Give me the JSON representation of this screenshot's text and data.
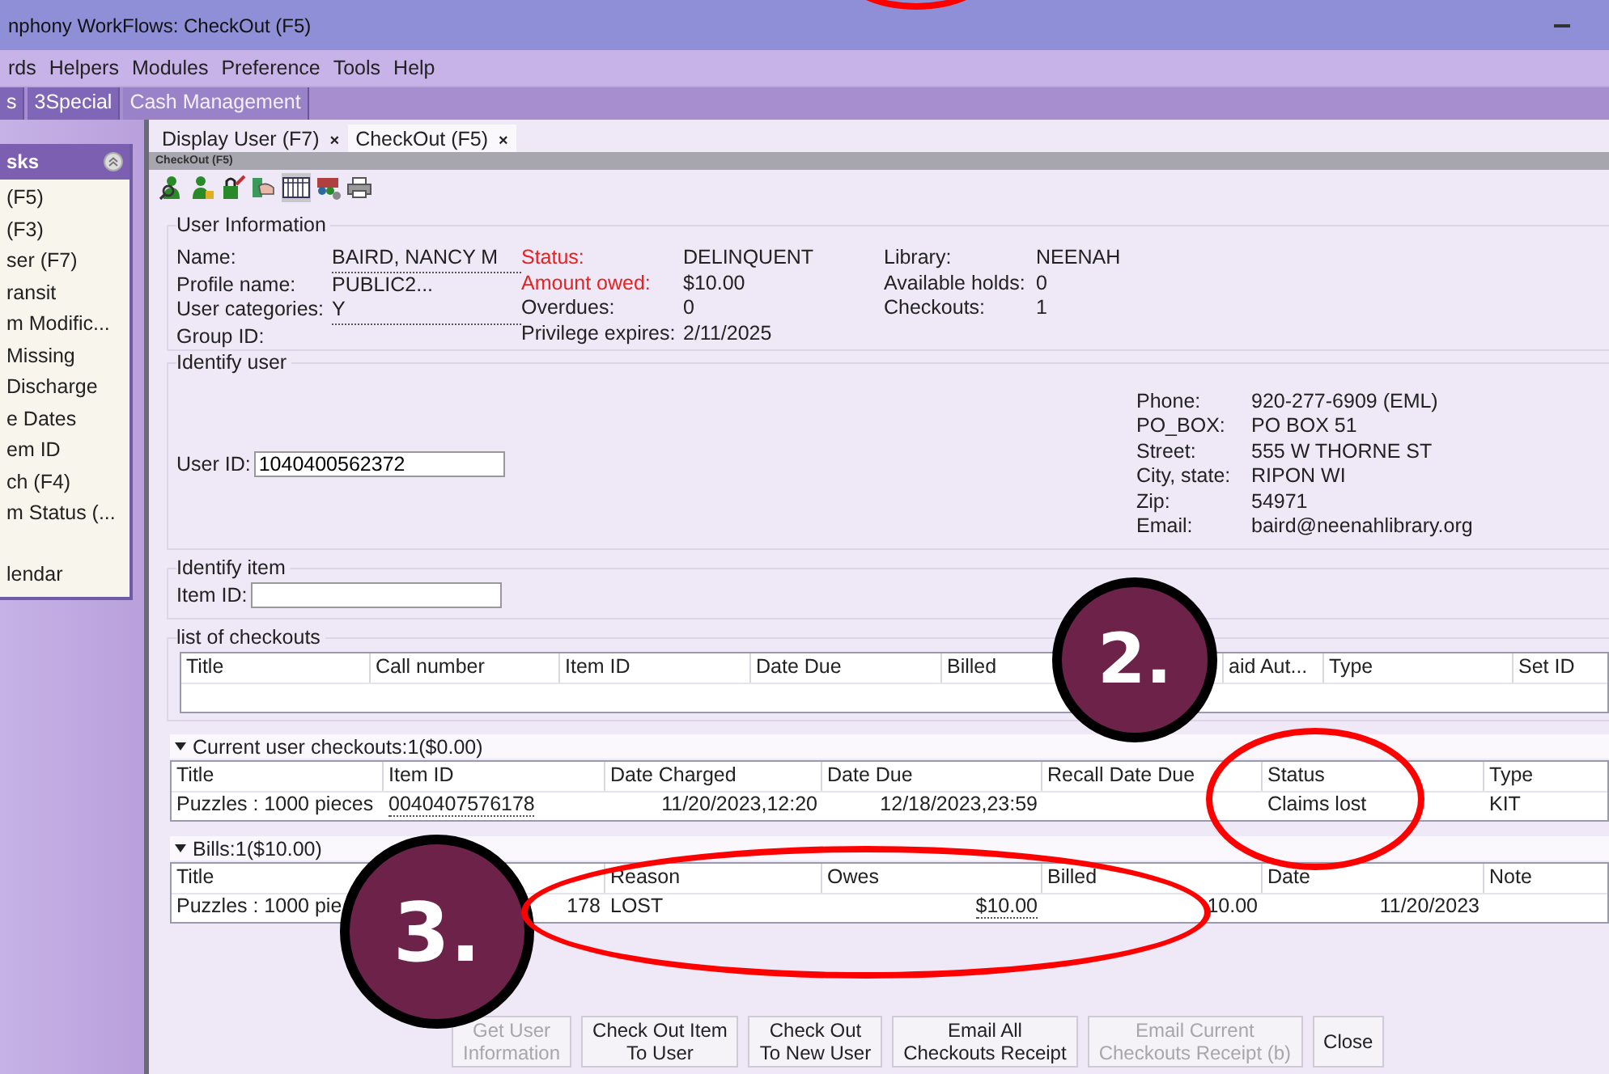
{
  "window": {
    "title": "nphony WorkFlows: CheckOut (F5)"
  },
  "menu": [
    "rds",
    "Helpers",
    "Modules",
    "Preference",
    "Tools",
    "Help"
  ],
  "toolbar_tabs": [
    {
      "label": "s",
      "selected": false
    },
    {
      "label": "3Special",
      "selected": false
    },
    {
      "label": "Cash Management",
      "selected": true
    }
  ],
  "sidebar": {
    "title": "sks",
    "groups": [
      [
        "(F5)",
        "(F3)",
        "ser (F7)",
        "ransit",
        "m Modific...",
        "Missing",
        "Discharge",
        "e Dates",
        "em ID",
        "ch (F4)",
        "m Status (..."
      ],
      [
        "lendar"
      ]
    ]
  },
  "tabs": [
    {
      "label": "Display User (F7)",
      "close": "×",
      "selected": false
    },
    {
      "label": "CheckOut (F5)",
      "close": "×",
      "selected": true
    }
  ],
  "panel_title": "CheckOut (F5)",
  "user_information": {
    "legend": "User Information",
    "columns": [
      [
        {
          "label": "Name:",
          "value": "BAIRD, NANCY M",
          "link": true,
          "alert": false
        },
        {
          "label": "Profile name:",
          "value": "PUBLIC2...",
          "link": false,
          "alert": false
        },
        {
          "label": "User categories:",
          "value": "Y",
          "link": true,
          "alert": false
        },
        {
          "label": "Group ID:",
          "alert": false
        }
      ],
      [
        {
          "label": "Status:",
          "value": "DELINQUENT",
          "link": false,
          "alert": true
        },
        {
          "label": "Amount owed:",
          "value": "$10.00",
          "link": false,
          "alert": true
        },
        {
          "label": "Overdues:",
          "value": "0",
          "link": false,
          "alert": false
        },
        {
          "label": "Privilege expires:",
          "value": "2/11/2025",
          "link": false,
          "alert": false
        }
      ],
      [
        {
          "label": "Library:",
          "value": "NEENAH",
          "link": false,
          "alert": false
        },
        {
          "label": "Available holds:",
          "value": "0",
          "link": false,
          "alert": false
        },
        {
          "label": "Checkouts:",
          "value": "1",
          "link": false,
          "alert": false
        }
      ]
    ]
  },
  "identify_user": {
    "legend": "Identify user",
    "field_label": "User ID:",
    "value": "1040400562372",
    "contact": [
      {
        "label": "Phone:",
        "value": "920-277-6909 (EML)"
      },
      {
        "label": "PO_BOX:",
        "value": "PO BOX 51"
      },
      {
        "label": "Street:",
        "value": "555 W THORNE ST"
      },
      {
        "label": "City, state:",
        "value": "RIPON WI"
      },
      {
        "label": "Zip:",
        "value": "54971"
      },
      {
        "label": "Email:",
        "value": "baird@neenahlibrary.org"
      }
    ]
  },
  "identify_item": {
    "legend": "Identify item",
    "field_label": "Item ID:"
  },
  "list_of_checkouts": {
    "legend": "list of checkouts",
    "columns": [
      "Title",
      "Call number",
      "Item ID",
      "Date Due",
      "Billed",
      "aid Aut...",
      "Type",
      "Set ID"
    ]
  },
  "current_checkouts": {
    "header": "Current user checkouts:1($0.00)",
    "expanded": true,
    "columns": [
      "Title",
      "Item ID",
      "Date Charged",
      "Date Due",
      "Recall Date Due",
      "Status",
      "Type"
    ],
    "rows": [
      [
        {
          "text": "Puzzles : 1000 pieces",
          "link": false
        },
        {
          "text": "0040407576178",
          "link": true
        },
        {
          "text": "11/20/2023,12:20",
          "link": false
        },
        {
          "text": "12/18/2023,23:59",
          "link": false
        },
        {
          "text": ""
        },
        {
          "text": "Claims lost",
          "link": false
        },
        {
          "text": "KIT",
          "link": false
        }
      ]
    ]
  },
  "bills": {
    "header": "Bills:1($10.00)",
    "expanded": true,
    "columns": [
      "Title",
      "",
      "Reason",
      "Owes",
      "Billed",
      "Date",
      "Note"
    ],
    "rows": [
      [
        {
          "text": "Puzzles : 1000 pie",
          "link": false
        },
        {
          "text": "178",
          "link": false
        },
        {
          "text": "LOST",
          "link": false
        },
        {
          "text": "$10.00",
          "link": true
        },
        {
          "text": "10.00",
          "link": false
        },
        {
          "text": "11/20/2023",
          "link": false
        },
        {
          "text": ""
        }
      ]
    ]
  },
  "buttons": [
    {
      "label": "Get User\nInformation",
      "disabled": true
    },
    {
      "label": "Check Out Item\nTo User",
      "disabled": false
    },
    {
      "label": "Check Out\nTo New User",
      "disabled": false
    },
    {
      "label": "Email All\nCheckouts Receipt",
      "disabled": false
    },
    {
      "label": "Email Current\nCheckouts Receipt (b)",
      "disabled": true
    },
    {
      "label": "Close",
      "disabled": false
    }
  ],
  "annotations": [
    {
      "kind": "number",
      "text": "2."
    },
    {
      "kind": "number",
      "text": "3."
    },
    {
      "kind": "ellipse"
    },
    {
      "kind": "ellipse"
    },
    {
      "kind": "ellipse"
    }
  ]
}
